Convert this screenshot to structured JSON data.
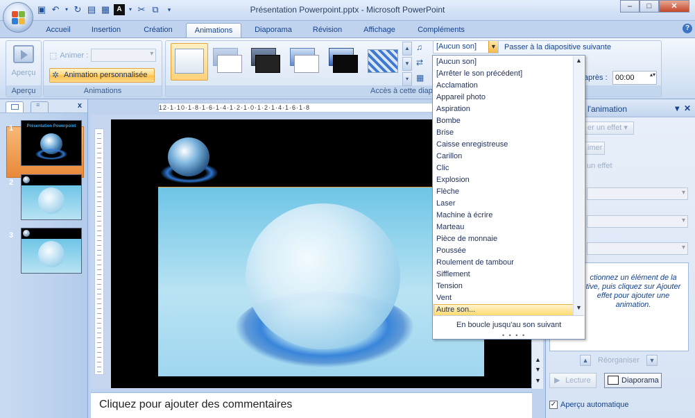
{
  "window": {
    "title": "Présentation Powerpoint.pptx - Microsoft PowerPoint",
    "minimize": "–",
    "maximize": "□",
    "close": "✕"
  },
  "tabs": [
    "Accueil",
    "Insertion",
    "Création",
    "Animations",
    "Diaporama",
    "Révision",
    "Affichage",
    "Compléments"
  ],
  "active_tab": "Animations",
  "ribbon": {
    "apercu_label": "Aperçu",
    "apercu_group": "Aperçu",
    "animer_label": "Animer :",
    "anim_perso_label": "Animation personnalisée",
    "animations_group": "Animations",
    "transition_group": "Accès à cette diap",
    "sound_value": "[Aucun son]",
    "passer_label": "Passer à la diapositive suivante",
    "apres_label": "après :",
    "apres_value": "00:00"
  },
  "dropdown": {
    "items": [
      "[Aucun son]",
      "[Arrêter le son précédent]",
      "Acclamation",
      "Appareil photo",
      "Aspiration",
      "Bombe",
      "Brise",
      "Caisse enregistreuse",
      "Carillon",
      "Clic",
      "Explosion",
      "Flèche",
      "Laser",
      "Machine à écrire",
      "Marteau",
      "Pièce de monnaie",
      "Poussée",
      "Roulement de tambour",
      "Sifflement",
      "Tension",
      "Vent",
      "Autre son..."
    ],
    "selected_index": 21,
    "loop_label": "En boucle jusqu'au son suivant",
    "dots": "• • • •"
  },
  "slides": [
    {
      "num": "1",
      "title": "Présentation Powerpoint"
    },
    {
      "num": "2"
    },
    {
      "num": "3"
    }
  ],
  "ruler": "12·1·10·1·8·1·6·1·4·1·2·1·0·1·2·1·4·1·6·1·8",
  "task_pane": {
    "title": "ser l'animation",
    "add_effect": "er un effet",
    "remove": "imer",
    "section": "un effet",
    "info": "ctionnez un élément de la tive, puis cliquez sur Ajouter effet pour ajouter une animation.",
    "reorganiser": "Réorganiser",
    "lecture": "Lecture",
    "diaporama": "Diaporama",
    "auto_preview": "Aperçu automatique"
  },
  "notes": {
    "placeholder": "Cliquez pour ajouter des commentaires"
  },
  "colors": {
    "ribbon_blue": "#bfd3ee",
    "accent_orange": "#ffc24a",
    "text_blue": "#15428b"
  }
}
